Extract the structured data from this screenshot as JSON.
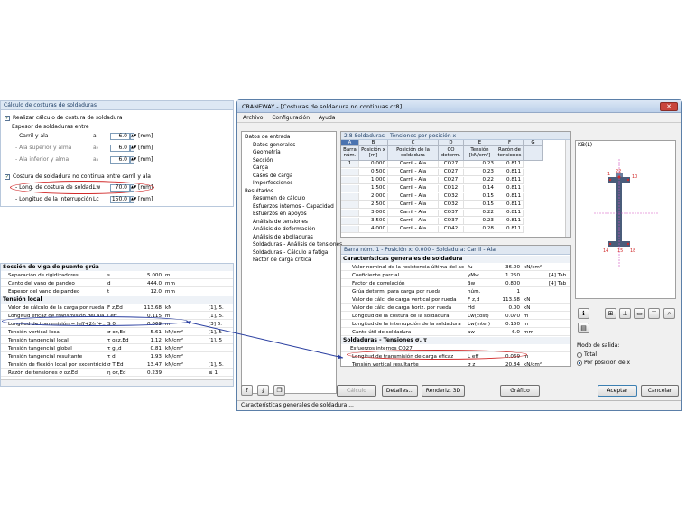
{
  "weld_panel": {
    "title": "Cálculo de costuras de soldaduras",
    "check1": "Realizar cálculo de costura de soldadura",
    "sub": "Espesor de soldaduras entre",
    "rows": [
      {
        "label": "- Carril y ala",
        "sym": "a",
        "value": "6.0",
        "unit": "[mm]"
      },
      {
        "label": "- Ala superior y alma",
        "sym": "a₂",
        "value": "6.0",
        "unit": "[mm]"
      },
      {
        "label": "- Ala inferior y alma",
        "sym": "a₃",
        "value": "6.0",
        "unit": "[mm]"
      }
    ],
    "check2": "Costura de soldadura no continua entre carril y ala",
    "long_label": "- Long. de costura de soldad.",
    "long_sym": "Lw",
    "long_value": "70.0",
    "long_unit": "[mm]",
    "int_label": "- Longitud de la interrupción",
    "int_sym": "Lc",
    "int_value": "150.0",
    "int_unit": "[mm]"
  },
  "left_table": {
    "groups": [
      {
        "title": "Sección de viga de puente grúa",
        "rows": [
          {
            "d": "Separación de rigidizadores",
            "s": "s",
            "v": "5.000",
            "u": "m",
            "r": ""
          },
          {
            "d": "Canto del vano de pandeo",
            "s": "d",
            "v": "444.0",
            "u": "mm",
            "r": ""
          },
          {
            "d": "Espesor del vano de pandeo",
            "s": "t",
            "v": "12.0",
            "mm": "",
            "u": "mm",
            "r": ""
          }
        ]
      },
      {
        "title": "Tensión local",
        "rows": [
          {
            "d": "Valor de cálculo de la carga por rueda",
            "s": "F z,Ed",
            "v": "113.68",
            "u": "kN",
            "r": "[1], 5."
          },
          {
            "d": "Longitud eficaz de transmisión del ala",
            "s": "l eff",
            "v": "0.115",
            "u": "m",
            "r": "[1], 5."
          },
          {
            "d": "Longitud de transmisión = leff+2(rf+...)",
            "s": "S 0",
            "v": "0.069",
            "u": "m",
            "r": "[3] 6."
          },
          {
            "d": "Tensión vertical local",
            "s": "σ oz,Ed",
            "v": "5.61",
            "u": "kN/cm²",
            "r": "[1], 5"
          },
          {
            "d": "Tensión tangencial local",
            "s": "τ oxz,Ed",
            "v": "1.12",
            "u": "kN/cm²",
            "r": "[1], 5"
          },
          {
            "d": "Tensión tangencial global",
            "s": "τ gl,d",
            "v": "0.81",
            "u": "kN/cm²",
            "r": ""
          },
          {
            "d": "Tensión tangencial resultante",
            "s": "τ d",
            "v": "1.93",
            "u": "kN/cm²",
            "r": ""
          },
          {
            "d": "Tensión de flexión local por excentricid.",
            "s": "σ T,Ed",
            "v": "13.47",
            "u": "kN/cm²",
            "r": "[1], 5."
          },
          {
            "d": "Razón de tensiones σ oz,Ed",
            "s": "η oz,Ed",
            "v": "0.239",
            "u": "",
            "r": "≤ 1"
          }
        ]
      }
    ]
  },
  "window": {
    "title": "CRANEWAY - [Costuras de soldadura no continuas.cr8]",
    "menu": [
      "Archivo",
      "Configuración",
      "Ayuda"
    ],
    "nav": [
      {
        "t": "Datos de entrada",
        "l": 0
      },
      {
        "t": "Datos generales",
        "l": 1
      },
      {
        "t": "Geometría",
        "l": 1
      },
      {
        "t": "Sección",
        "l": 1
      },
      {
        "t": "Carga",
        "l": 1
      },
      {
        "t": "Casos de carga",
        "l": 1
      },
      {
        "t": "Imperfecciones",
        "l": 1
      },
      {
        "t": "Resultados",
        "l": 0
      },
      {
        "t": "Resumen de cálculo",
        "l": 1
      },
      {
        "t": "Esfuerzos internos - Capacidad",
        "l": 1
      },
      {
        "t": "Esfuerzos en apoyos",
        "l": 1
      },
      {
        "t": "Análisis de tensiones",
        "l": 1
      },
      {
        "t": "Análisis de deformación",
        "l": 1
      },
      {
        "t": "Análisis de abolladuras",
        "l": 1
      },
      {
        "t": "Soldaduras - Análisis de tensiones",
        "l": 1
      },
      {
        "t": "Soldaduras - Cálculo a fatiga",
        "l": 1
      },
      {
        "t": "Factor de carga crítica",
        "l": 1
      }
    ],
    "table_title": "2.8 Soldaduras - Tensiones por posición x",
    "col_letters": [
      "A",
      "B",
      "C",
      "D",
      "E",
      "F",
      "G"
    ],
    "col_heads": [
      "Barra núm.",
      "Posición x [m]",
      "Posición de la soldadura",
      "CO determ.",
      "Tensión [kN/cm²]",
      "Razón de tensiones",
      ""
    ],
    "rows": [
      [
        "1",
        "0.000",
        "Carril - Ala",
        "CO27",
        "0.23",
        "0.811"
      ],
      [
        "",
        "0.500",
        "Carril - Ala",
        "CO27",
        "0.23",
        "0.811"
      ],
      [
        "",
        "1.000",
        "Carril - Ala",
        "CO27",
        "0.22",
        "0.811"
      ],
      [
        "",
        "1.500",
        "Carril - Ala",
        "CO12",
        "0.14",
        "0.811"
      ],
      [
        "",
        "2.000",
        "Carril - Ala",
        "CO32",
        "0.15",
        "0.811"
      ],
      [
        "",
        "2.500",
        "Carril - Ala",
        "CO32",
        "0.15",
        "0.811"
      ],
      [
        "",
        "3.000",
        "Carril - Ala",
        "CO37",
        "0.22",
        "0.811"
      ],
      [
        "",
        "3.500",
        "Carril - Ala",
        "CO37",
        "0.23",
        "0.811"
      ],
      [
        "",
        "4.000",
        "Carril - Ala",
        "CO42",
        "0.28",
        "0.811"
      ]
    ],
    "detail_title": "Barra núm. 1 - Posición x: 0.000 - Soldadura: Carril - Ala",
    "detail_group1": "Características generales de soldadura",
    "detail_rows1": [
      {
        "d": "Valor nominal de la resistencia última del acero",
        "s": "fu",
        "v": "36.00",
        "u": "kN/cm²",
        "r": ""
      },
      {
        "d": "Coeficiente parcial",
        "s": "γMw",
        "v": "1.250",
        "u": "",
        "r": "[4] Tab"
      },
      {
        "d": "Factor de correlación",
        "s": "βw",
        "v": "0.800",
        "u": "",
        "r": "[4] Tab"
      },
      {
        "d": "Grúa determ. para carga por rueda",
        "s": "núm.",
        "v": "1",
        "u": "",
        "r": ""
      },
      {
        "d": "Valor de cálc. de carga vertical por rueda",
        "s": "F z,d",
        "v": "113.68",
        "u": "kN",
        "r": ""
      },
      {
        "d": "Valor de cálc. de carga horiz. por rueda",
        "s": "Hd",
        "v": "0.00",
        "u": "kN",
        "r": ""
      },
      {
        "d": "Longitud de la costura de la soldadura",
        "s": "Lw(cost)",
        "v": "0.070",
        "u": "m",
        "r": ""
      },
      {
        "d": "Longitud de la interrupción de la soldadura",
        "s": "Lw(inter)",
        "v": "0.150",
        "u": "m",
        "r": ""
      },
      {
        "d": "Canto útil de soldadura",
        "s": "aw",
        "v": "6.0",
        "u": "mm",
        "r": ""
      }
    ],
    "detail_group2": "Soldaduras - Tensiones σ, τ",
    "detail_sub2": "Esfuerzos internos CO27",
    "detail_rows2": [
      {
        "d": "Longitud de transmisión de carga eficaz",
        "s": "L eff",
        "v": "0.069",
        "u": "m",
        "r": ""
      },
      {
        "d": "Tensión vertical resultante",
        "s": "σ z",
        "v": "20.84",
        "u": "kN/cm²",
        "r": ""
      }
    ],
    "sketch_label": "KB(L)",
    "sketch_nums": [
      "1",
      "22",
      "10",
      "14",
      "18",
      "15"
    ],
    "output_title": "Modo de salida:",
    "opt1": "Total",
    "opt2": "Por posición de x",
    "btn_calc": "Cálculo",
    "btn_det": "Detalles...",
    "btn_3d": "Renderiz. 3D",
    "btn_graf": "Gráfico",
    "btn_ok": "Aceptar",
    "btn_cancel": "Cancelar",
    "status": "Características generales de soldadura ...",
    "dot": "..."
  },
  "colors": {
    "red": "#d12a2a",
    "blue": "#2a3fa0",
    "accent": "#1f3f66"
  }
}
